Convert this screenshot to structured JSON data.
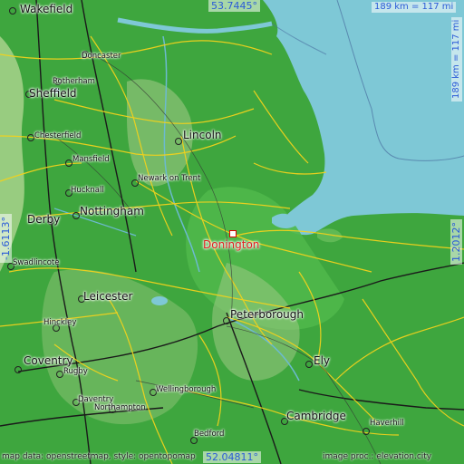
{
  "map": {
    "place": "Donington",
    "latitude_top": "53.7445°",
    "latitude_bottom": "52.04811°",
    "longitude_left": "-1.6113°",
    "longitude_right": "1.2012°",
    "scale_horizontal": "189 km = 117 mi",
    "scale_vertical": "189 km = 117 mi",
    "credit_left": "map data: openstreetmap, style: opentopomap",
    "credit_right": "image proc.: elevation.city"
  },
  "towns": [
    {
      "name": "Wakefield"
    },
    {
      "name": "Doncaster"
    },
    {
      "name": "Rotherham"
    },
    {
      "name": "Sheffield"
    },
    {
      "name": "Chesterfield"
    },
    {
      "name": "Lincoln"
    },
    {
      "name": "Mansfield"
    },
    {
      "name": "Newark on Trent"
    },
    {
      "name": "Hucknall"
    },
    {
      "name": "Nottingham"
    },
    {
      "name": "Derby"
    },
    {
      "name": "Swadlincote"
    },
    {
      "name": "Leicester"
    },
    {
      "name": "Peterborough"
    },
    {
      "name": "Hinckley"
    },
    {
      "name": "Coventry"
    },
    {
      "name": "Rugby"
    },
    {
      "name": "Ely"
    },
    {
      "name": "Wellingborough"
    },
    {
      "name": "Daventry"
    },
    {
      "name": "Northampton"
    },
    {
      "name": "Cambridge"
    },
    {
      "name": "Bedford"
    },
    {
      "name": "Haverhill"
    }
  ],
  "colors": {
    "sea": "#7ec8d6",
    "lowland": "#3ea63e",
    "marsh": "#4fb84a",
    "hills": "#a8d28c",
    "roads": "#f2d21c",
    "highlight": "#e02020",
    "coord_text": "#2a5bd7"
  }
}
